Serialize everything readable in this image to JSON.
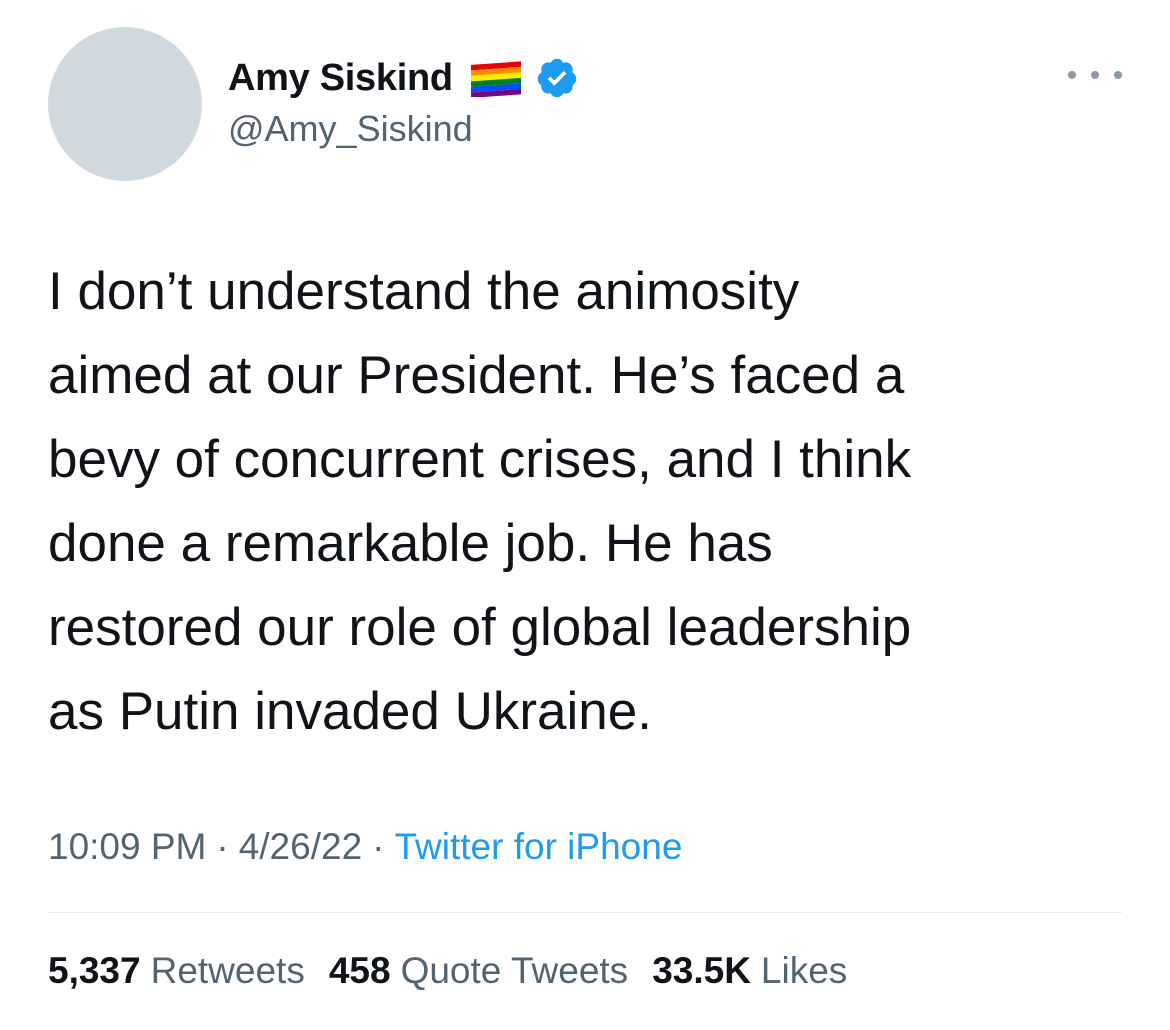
{
  "author": {
    "display_name": "Amy Siskind",
    "handle": "@Amy_Siskind",
    "flag_icon": "rainbow-flag-icon",
    "verified_icon": "verified-badge-icon"
  },
  "tweet": {
    "lines": [
      "I don’t understand the animosity",
      "aimed at our President. He’s faced a",
      "bevy of concurrent crises, and I think",
      "done a remarkable job. He has",
      "restored our role of global leadership",
      "as Putin invaded Ukraine."
    ],
    "time": "10:09 PM",
    "date": "4/26/22",
    "separator": "·",
    "source": "Twitter for iPhone"
  },
  "stats": {
    "retweets_count": "5,337",
    "retweets_label": "Retweets",
    "quotes_count": "458",
    "quotes_label": "Quote Tweets",
    "likes_count": "33.5K",
    "likes_label": "Likes"
  },
  "colors": {
    "text_primary": "#0f1419",
    "text_secondary": "#536471",
    "link": "#1d9bf0",
    "avatar_placeholder": "#cfd9de"
  }
}
